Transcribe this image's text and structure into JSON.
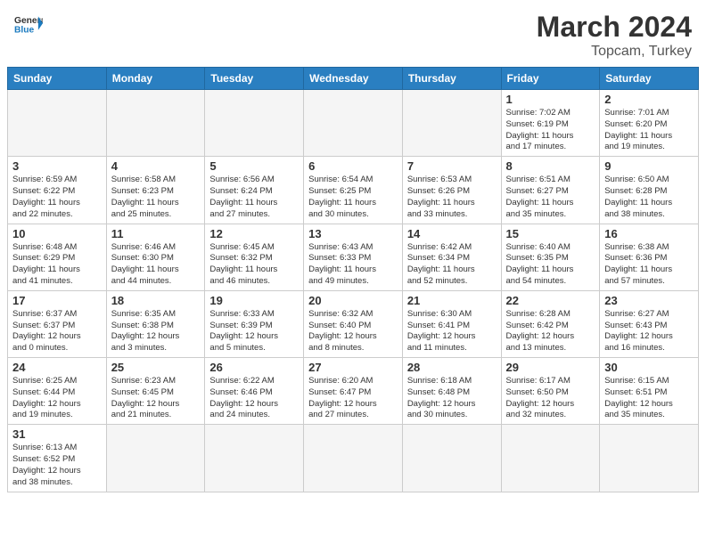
{
  "header": {
    "logo_general": "General",
    "logo_blue": "Blue",
    "month_year": "March 2024",
    "location": "Topcam, Turkey"
  },
  "days_of_week": [
    "Sunday",
    "Monday",
    "Tuesday",
    "Wednesday",
    "Thursday",
    "Friday",
    "Saturday"
  ],
  "weeks": [
    [
      {
        "day": "",
        "info": ""
      },
      {
        "day": "",
        "info": ""
      },
      {
        "day": "",
        "info": ""
      },
      {
        "day": "",
        "info": ""
      },
      {
        "day": "",
        "info": ""
      },
      {
        "day": "1",
        "info": "Sunrise: 7:02 AM\nSunset: 6:19 PM\nDaylight: 11 hours\nand 17 minutes."
      },
      {
        "day": "2",
        "info": "Sunrise: 7:01 AM\nSunset: 6:20 PM\nDaylight: 11 hours\nand 19 minutes."
      }
    ],
    [
      {
        "day": "3",
        "info": "Sunrise: 6:59 AM\nSunset: 6:22 PM\nDaylight: 11 hours\nand 22 minutes."
      },
      {
        "day": "4",
        "info": "Sunrise: 6:58 AM\nSunset: 6:23 PM\nDaylight: 11 hours\nand 25 minutes."
      },
      {
        "day": "5",
        "info": "Sunrise: 6:56 AM\nSunset: 6:24 PM\nDaylight: 11 hours\nand 27 minutes."
      },
      {
        "day": "6",
        "info": "Sunrise: 6:54 AM\nSunset: 6:25 PM\nDaylight: 11 hours\nand 30 minutes."
      },
      {
        "day": "7",
        "info": "Sunrise: 6:53 AM\nSunset: 6:26 PM\nDaylight: 11 hours\nand 33 minutes."
      },
      {
        "day": "8",
        "info": "Sunrise: 6:51 AM\nSunset: 6:27 PM\nDaylight: 11 hours\nand 35 minutes."
      },
      {
        "day": "9",
        "info": "Sunrise: 6:50 AM\nSunset: 6:28 PM\nDaylight: 11 hours\nand 38 minutes."
      }
    ],
    [
      {
        "day": "10",
        "info": "Sunrise: 6:48 AM\nSunset: 6:29 PM\nDaylight: 11 hours\nand 41 minutes."
      },
      {
        "day": "11",
        "info": "Sunrise: 6:46 AM\nSunset: 6:30 PM\nDaylight: 11 hours\nand 44 minutes."
      },
      {
        "day": "12",
        "info": "Sunrise: 6:45 AM\nSunset: 6:32 PM\nDaylight: 11 hours\nand 46 minutes."
      },
      {
        "day": "13",
        "info": "Sunrise: 6:43 AM\nSunset: 6:33 PM\nDaylight: 11 hours\nand 49 minutes."
      },
      {
        "day": "14",
        "info": "Sunrise: 6:42 AM\nSunset: 6:34 PM\nDaylight: 11 hours\nand 52 minutes."
      },
      {
        "day": "15",
        "info": "Sunrise: 6:40 AM\nSunset: 6:35 PM\nDaylight: 11 hours\nand 54 minutes."
      },
      {
        "day": "16",
        "info": "Sunrise: 6:38 AM\nSunset: 6:36 PM\nDaylight: 11 hours\nand 57 minutes."
      }
    ],
    [
      {
        "day": "17",
        "info": "Sunrise: 6:37 AM\nSunset: 6:37 PM\nDaylight: 12 hours\nand 0 minutes."
      },
      {
        "day": "18",
        "info": "Sunrise: 6:35 AM\nSunset: 6:38 PM\nDaylight: 12 hours\nand 3 minutes."
      },
      {
        "day": "19",
        "info": "Sunrise: 6:33 AM\nSunset: 6:39 PM\nDaylight: 12 hours\nand 5 minutes."
      },
      {
        "day": "20",
        "info": "Sunrise: 6:32 AM\nSunset: 6:40 PM\nDaylight: 12 hours\nand 8 minutes."
      },
      {
        "day": "21",
        "info": "Sunrise: 6:30 AM\nSunset: 6:41 PM\nDaylight: 12 hours\nand 11 minutes."
      },
      {
        "day": "22",
        "info": "Sunrise: 6:28 AM\nSunset: 6:42 PM\nDaylight: 12 hours\nand 13 minutes."
      },
      {
        "day": "23",
        "info": "Sunrise: 6:27 AM\nSunset: 6:43 PM\nDaylight: 12 hours\nand 16 minutes."
      }
    ],
    [
      {
        "day": "24",
        "info": "Sunrise: 6:25 AM\nSunset: 6:44 PM\nDaylight: 12 hours\nand 19 minutes."
      },
      {
        "day": "25",
        "info": "Sunrise: 6:23 AM\nSunset: 6:45 PM\nDaylight: 12 hours\nand 21 minutes."
      },
      {
        "day": "26",
        "info": "Sunrise: 6:22 AM\nSunset: 6:46 PM\nDaylight: 12 hours\nand 24 minutes."
      },
      {
        "day": "27",
        "info": "Sunrise: 6:20 AM\nSunset: 6:47 PM\nDaylight: 12 hours\nand 27 minutes."
      },
      {
        "day": "28",
        "info": "Sunrise: 6:18 AM\nSunset: 6:48 PM\nDaylight: 12 hours\nand 30 minutes."
      },
      {
        "day": "29",
        "info": "Sunrise: 6:17 AM\nSunset: 6:50 PM\nDaylight: 12 hours\nand 32 minutes."
      },
      {
        "day": "30",
        "info": "Sunrise: 6:15 AM\nSunset: 6:51 PM\nDaylight: 12 hours\nand 35 minutes."
      }
    ],
    [
      {
        "day": "31",
        "info": "Sunrise: 6:13 AM\nSunset: 6:52 PM\nDaylight: 12 hours\nand 38 minutes."
      },
      {
        "day": "",
        "info": ""
      },
      {
        "day": "",
        "info": ""
      },
      {
        "day": "",
        "info": ""
      },
      {
        "day": "",
        "info": ""
      },
      {
        "day": "",
        "info": ""
      },
      {
        "day": "",
        "info": ""
      }
    ]
  ]
}
